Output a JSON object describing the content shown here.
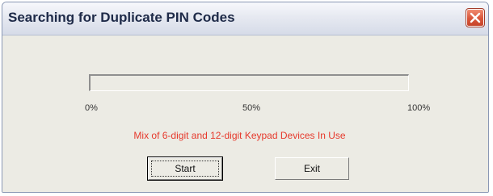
{
  "window": {
    "title": "Searching for Duplicate PIN Codes",
    "close_icon": "close-icon"
  },
  "progress": {
    "value_percent": 0,
    "ticks": [
      "0%",
      "50%",
      "100%"
    ]
  },
  "message": {
    "text": "Mix of 6-digit and 12-digit Keypad Devices In Use",
    "color": "#e6392c"
  },
  "buttons": {
    "start_label": "Start",
    "exit_label": "Exit"
  }
}
